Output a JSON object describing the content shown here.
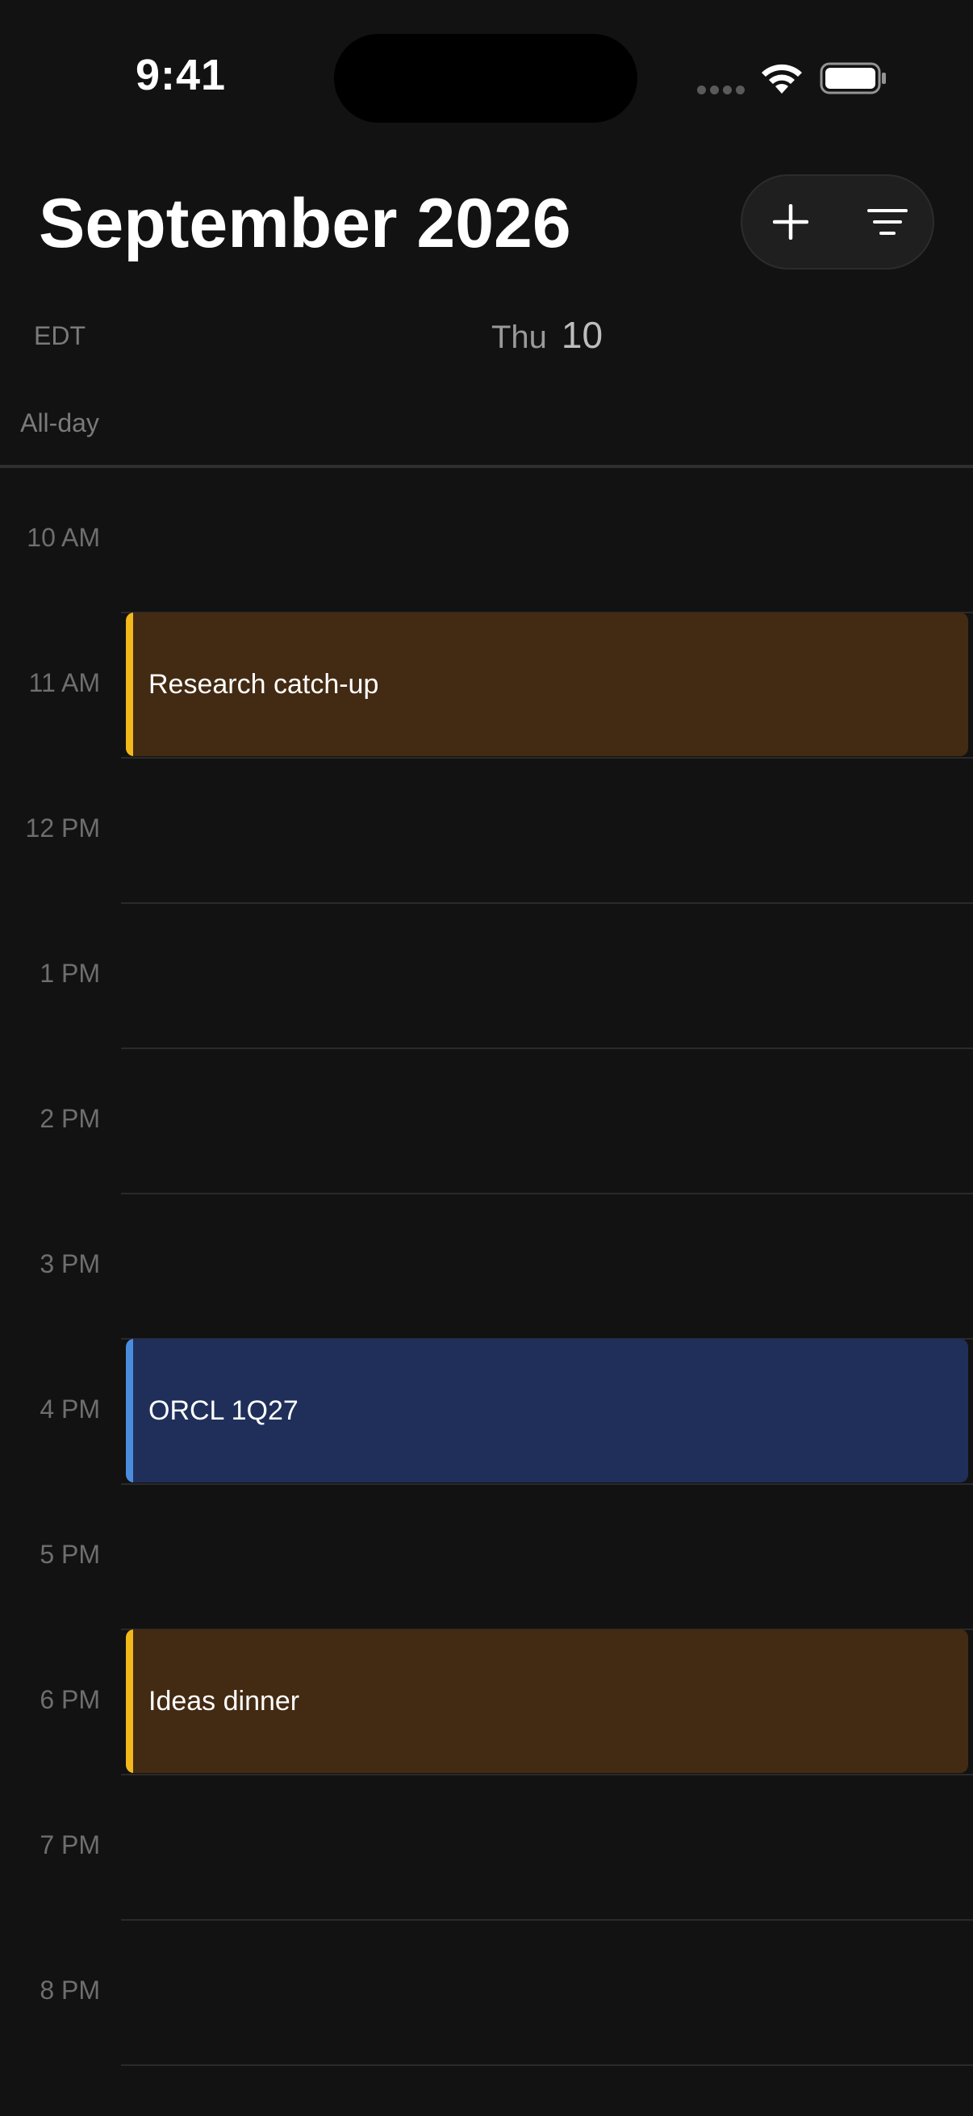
{
  "status_bar": {
    "time": "9:41"
  },
  "header": {
    "title": "September 2026",
    "add_icon": "plus-icon",
    "filter_icon": "filter-lines-icon"
  },
  "day_view": {
    "timezone": "EDT",
    "day_of_week": "Thu",
    "day_of_month": "10",
    "all_day_label": "All-day",
    "hours": [
      "10 AM",
      "11 AM",
      "12 PM",
      "1 PM",
      "2 PM",
      "3 PM",
      "4 PM",
      "5 PM",
      "6 PM",
      "7 PM",
      "8 PM"
    ],
    "events": [
      {
        "title": "Research catch-up",
        "fill": "#432a12",
        "accent": "#f3b81a"
      },
      {
        "title": "ORCL 1Q27",
        "fill": "#1f2f5a",
        "accent": "#4a8de0"
      },
      {
        "title": "Ideas dinner",
        "fill": "#432a12",
        "accent": "#f3b81a"
      }
    ]
  },
  "colors": {
    "background": "#121212",
    "toolbar_pill": "#1f1f1f",
    "gridline": "#2a2a2a",
    "hour_label": "#6e6e6e"
  }
}
